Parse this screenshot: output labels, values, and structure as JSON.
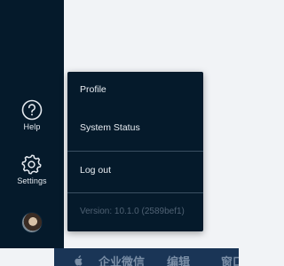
{
  "sidebar": {
    "help_label": "Help",
    "settings_label": "Settings"
  },
  "menu": {
    "items": [
      {
        "label": "Profile"
      },
      {
        "label": "System Status"
      },
      {
        "label": "Log out"
      }
    ],
    "version": "Version: 10.1.0 (2589bef1)"
  },
  "mac_menubar": {
    "app_name": "企业微信",
    "edit": "编辑",
    "window": "窗口"
  },
  "colors": {
    "sidebar_bg": "#051a2b",
    "menu_bg": "#051a2b",
    "content_bg": "#f1f3f6",
    "menubar_bg": "#1a3556"
  }
}
